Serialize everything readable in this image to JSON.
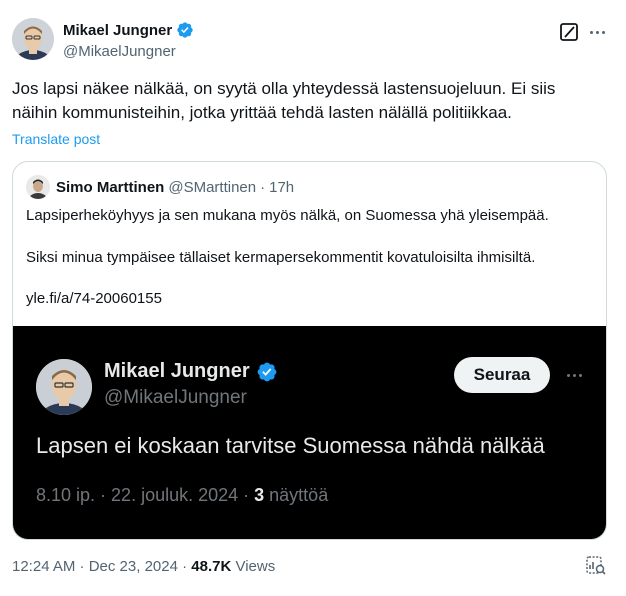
{
  "author": {
    "name": "Mikael Jungner",
    "handle": "@MikaelJungner"
  },
  "post": {
    "line1": "Jos lapsi näkee nälkää, on syytä olla yhteydessä lastensuojeluun. Ei siis",
    "line2": "näihin kommunisteihin, jotka yrittää tehdä lasten nälällä politiikkaa.",
    "translate_label": "Translate post"
  },
  "quote": {
    "name": "Simo Marttinen",
    "handle": "@SMarttinen",
    "separator": "·",
    "time": "17h",
    "line1": "Lapsiperheköyhyys ja sen mukana myös nälkä, on Suomessa yhä yleisempää.",
    "line2": "Siksi minua tympäisee tällaiset kermapersekommentit kovatuloisilta ihmisiltä.",
    "link": "yle.fi/a/74-20060155"
  },
  "screenshot": {
    "name": "Mikael Jungner",
    "handle": "@MikaelJungner",
    "follow_label": "Seuraa",
    "text": "Lapsen ei koskaan tarvitse Suomessa nähdä nälkää",
    "meta_prefix": "8.10 ip. · 22. jouluk. 2024 · ",
    "views_count": "3",
    "views_label": " näyttöä"
  },
  "footer": {
    "time": "12:24 AM · Dec 23, 2024 · ",
    "views_count": "48.7K",
    "views_label": " Views"
  },
  "colors": {
    "verified": "#1d9bf0",
    "link": "#1d9bf0",
    "muted": "#536471"
  },
  "icons": {
    "verified": "verified-badge-icon",
    "grok": "grok-icon",
    "more": "more-dots-icon",
    "analytics": "analytics-icon"
  }
}
